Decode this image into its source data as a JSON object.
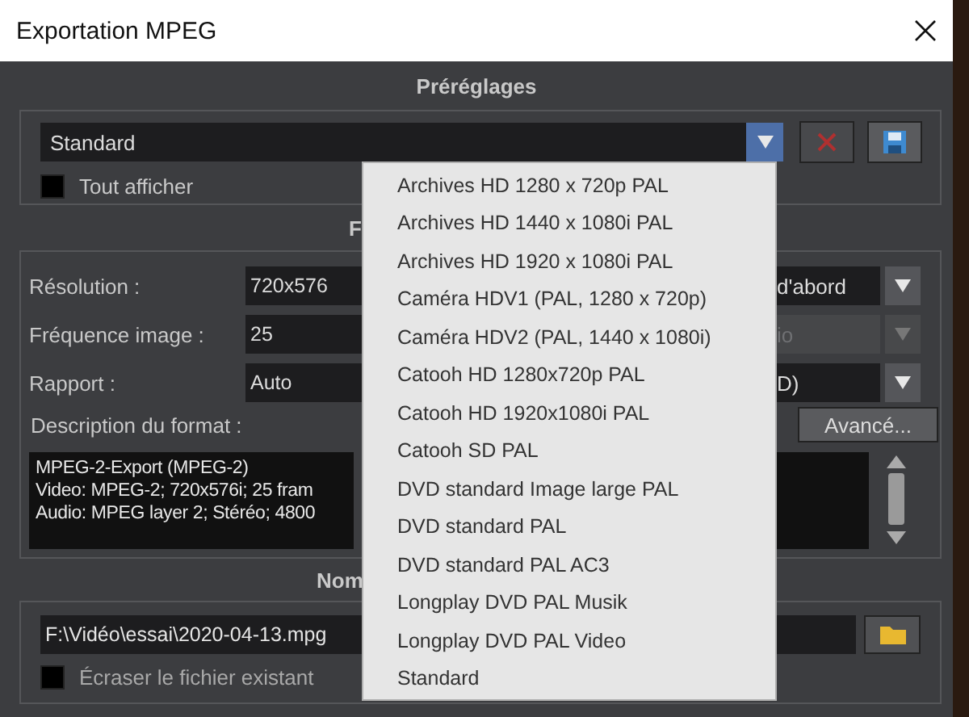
{
  "window": {
    "title": "Exportation MPEG"
  },
  "presets": {
    "heading": "Préréglages",
    "combo": {
      "value": "Standard",
      "expanded": true
    },
    "show_all": {
      "label": "Tout afficher",
      "checked": false
    }
  },
  "preset_menu": {
    "items": [
      {
        "label": "Archives HD 1280 x 720p PAL",
        "selected": false
      },
      {
        "label": "Archives HD 1440 x 1080i PAL",
        "selected": false
      },
      {
        "label": "Archives HD 1920 x 1080i PAL",
        "selected": false
      },
      {
        "label": "Caméra HDV1 (PAL, 1280 x 720p)",
        "selected": false
      },
      {
        "label": "Caméra HDV2 (PAL, 1440 x 1080i)",
        "selected": false
      },
      {
        "label": "Catooh HD 1280x720p PAL",
        "selected": false
      },
      {
        "label": "Catooh HD 1920x1080i PAL",
        "selected": false
      },
      {
        "label": "Catooh SD PAL",
        "selected": false
      },
      {
        "label": "DVD standard Image large PAL",
        "selected": false
      },
      {
        "label": "DVD standard PAL",
        "selected": false
      },
      {
        "label": "DVD standard PAL AC3",
        "selected": false
      },
      {
        "label": "Longplay DVD PAL Musik",
        "selected": false
      },
      {
        "label": "Longplay DVD PAL Video",
        "selected": false
      },
      {
        "label": "Standard",
        "selected": false
      }
    ]
  },
  "format": {
    "heading": "F",
    "rows": [
      {
        "label": "Résolution :",
        "value": "720x576",
        "right_value": "d'abord",
        "disabled": false
      },
      {
        "label": "Fréquence image :",
        "value": "25",
        "right_value": "io",
        "disabled": true
      },
      {
        "label": "Rapport :",
        "value": "Auto",
        "right_value": "D)",
        "disabled": false
      }
    ],
    "description_label": "Description du format :",
    "advanced_button": "Avancé...",
    "description_lines": [
      "MPEG-2-Export (MPEG-2)",
      "Video: MPEG-2; 720x576i; 25 fram",
      "Audio: MPEG layer 2; Stéréo; 4800"
    ]
  },
  "output": {
    "heading": "Nom",
    "path": "F:\\Vidéo\\essai\\2020-04-13.mpg",
    "overwrite": {
      "label": "Écraser le fichier existant",
      "checked": false
    }
  }
}
